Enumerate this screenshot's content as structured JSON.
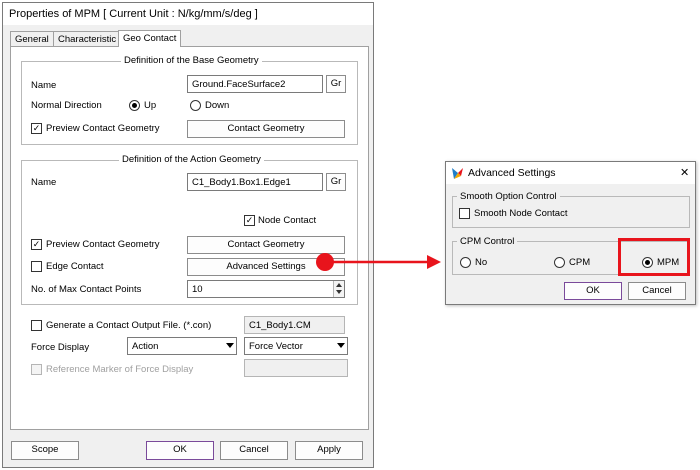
{
  "main_dialog": {
    "title": "Properties of MPM [ Current Unit : N/kg/mm/s/deg ]",
    "tabs": [
      {
        "label": "General"
      },
      {
        "label": "Characteristic"
      },
      {
        "label": "Geo Contact",
        "active": true
      }
    ],
    "base_geometry": {
      "title": "Definition of the Base Geometry",
      "name_label": "Name",
      "name_value": "Ground.FaceSurface2",
      "gr_label": "Gr",
      "normal_direction_label": "Normal Direction",
      "up_label": "Up",
      "down_label": "Down",
      "normal_direction_selected": "Up",
      "preview_label": "Preview Contact Geometry",
      "preview_checked": true,
      "contact_geometry_button": "Contact Geometry"
    },
    "action_geometry": {
      "title": "Definition of the Action Geometry",
      "name_label": "Name",
      "name_value": "C1_Body1.Box1.Edge1",
      "gr_label": "Gr",
      "node_contact_label": "Node Contact",
      "node_contact_checked": true,
      "preview_label": "Preview Contact Geometry",
      "preview_checked": true,
      "contact_geometry_button": "Contact Geometry",
      "edge_contact_label": "Edge Contact",
      "edge_contact_checked": false,
      "advanced_settings_button": "Advanced Settings",
      "max_contact_points_label": "No. of Max Contact Points",
      "max_contact_points_value": "10"
    },
    "output_file": {
      "label": "Generate a Contact Output File. (*.con)",
      "checked": false,
      "value": "C1_Body1.CM"
    },
    "force_display": {
      "label": "Force Display",
      "selected": "Action",
      "vector_selected": "Force Vector"
    },
    "reference_marker": {
      "label": "Reference Marker of Force Display",
      "checked": false,
      "enabled": false
    },
    "buttons": {
      "scope": "Scope",
      "ok": "OK",
      "cancel": "Cancel",
      "apply": "Apply"
    }
  },
  "advanced_dialog": {
    "title": "Advanced Settings",
    "close_label": "✕",
    "smooth_option": {
      "title": "Smooth Option Control",
      "smooth_node_contact_label": "Smooth Node Contact",
      "checked": false
    },
    "cpm_control": {
      "title": "CPM Control",
      "options": [
        "No",
        "CPM",
        "MPM"
      ],
      "selected": "MPM"
    },
    "ok": "OK",
    "cancel": "Cancel"
  },
  "annotation": {
    "highlight_color": "#e8141c",
    "marker_color": "#e8141c"
  }
}
